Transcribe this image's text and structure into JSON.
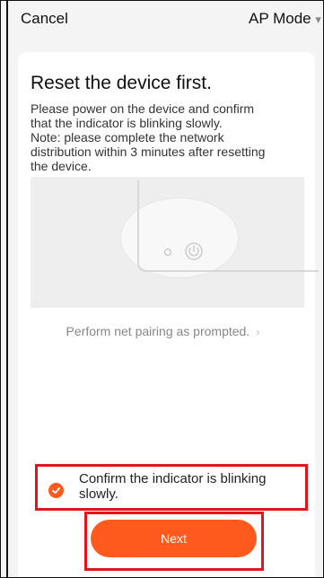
{
  "topbar": {
    "cancel_label": "Cancel",
    "mode_label": "AP Mode"
  },
  "main": {
    "title": "Reset the device first.",
    "description_lines": [
      "Please power on the device and confirm",
      "that the indicator is blinking slowly.",
      "Note: please complete the network",
      "distribution within 3 minutes after resetting",
      "the device."
    ],
    "illustration_icons": [
      "indicator-led-icon",
      "power-button-icon"
    ],
    "prompt_link_label": "Perform net pairing as prompted."
  },
  "confirm": {
    "label": "Confirm the indicator is blinking slowly.",
    "checked": true
  },
  "actions": {
    "next_label": "Next"
  },
  "colors": {
    "accent": "#ff5a1e",
    "annotation_red": "#e3141b"
  }
}
